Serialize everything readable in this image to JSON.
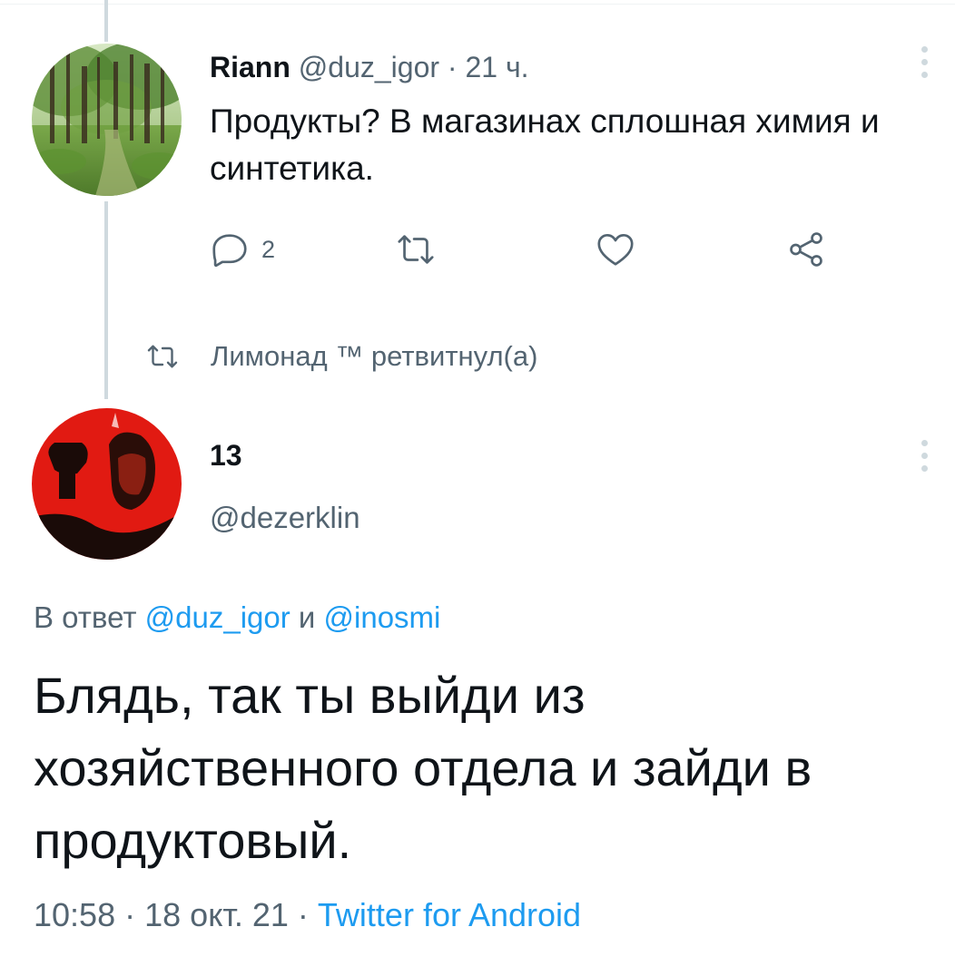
{
  "tweet1": {
    "display_name": "Riann",
    "handle": "@duz_igor",
    "separator": "·",
    "time": "21 ч.",
    "text": "Продукты?  В магазинах сплошная химия и синтетика.",
    "reply_count": "2",
    "icons": {
      "reply": "comment-bubble-icon",
      "retweet": "retweet-icon",
      "like": "heart-icon",
      "share": "share-icon",
      "more": "more-vertical-icon"
    }
  },
  "retweet_notice": {
    "text": "Лимонад ™ ретвитнул(а)",
    "icon": "retweet-icon"
  },
  "tweet2": {
    "display_name": "13",
    "handle": "@dezerklin",
    "reply_prefix": "В ответ",
    "reply_user1": "@duz_igor",
    "reply_conj": "и",
    "reply_user2": "@inosmi",
    "text": "Блядь, так ты выйди из хозяйственного отдела и зайди в продуктовый.",
    "time": "10:58",
    "separator": "·",
    "date": "18 окт. 21",
    "source": "Twitter for Android"
  },
  "colors": {
    "text_primary": "#0f1419",
    "text_secondary": "#536471",
    "link": "#1d9bf0",
    "thread_line": "#cfd9de"
  }
}
